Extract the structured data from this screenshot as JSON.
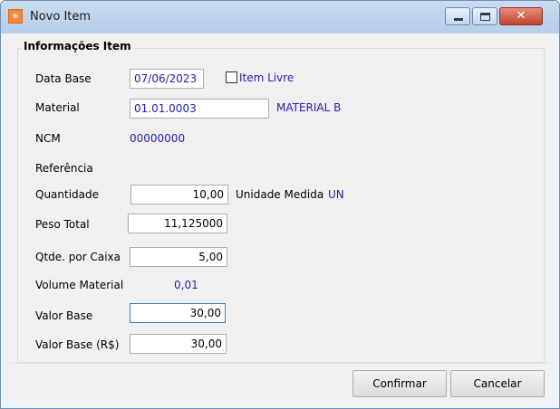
{
  "window": {
    "title": "Novo Item",
    "app_icon_glyph": "✳"
  },
  "group": {
    "title": "Informações Item"
  },
  "fields": {
    "data_base": {
      "label": "Data Base",
      "value": "07/06/2023"
    },
    "item_livre": {
      "label": "Item Livre",
      "checked": false
    },
    "material": {
      "label": "Material",
      "value": "01.01.0003",
      "description": "MATERIAL B"
    },
    "ncm": {
      "label": "NCM",
      "value": "00000000"
    },
    "referencia": {
      "label": "Referência"
    },
    "quantidade": {
      "label": "Quantidade",
      "value": "10,00"
    },
    "unidade_medida": {
      "label": "Unidade Medida",
      "value": "UN"
    },
    "peso_total": {
      "label": "Peso Total",
      "value": "11,125000"
    },
    "qtde_caixa": {
      "label": "Qtde. por Caixa",
      "value": "5,00"
    },
    "volume_material": {
      "label": "Volume Material",
      "value": "0,01"
    },
    "valor_base": {
      "label": "Valor Base",
      "value": "30,00"
    },
    "valor_base_rs": {
      "label": "Valor Base (R$)",
      "value": "30,00"
    }
  },
  "buttons": {
    "confirmar": "Confirmar",
    "cancelar": "Cancelar"
  },
  "colors": {
    "value_text": "#1f1fb0",
    "titlebar": "#c9dcf1",
    "close_button": "#c1432f"
  }
}
